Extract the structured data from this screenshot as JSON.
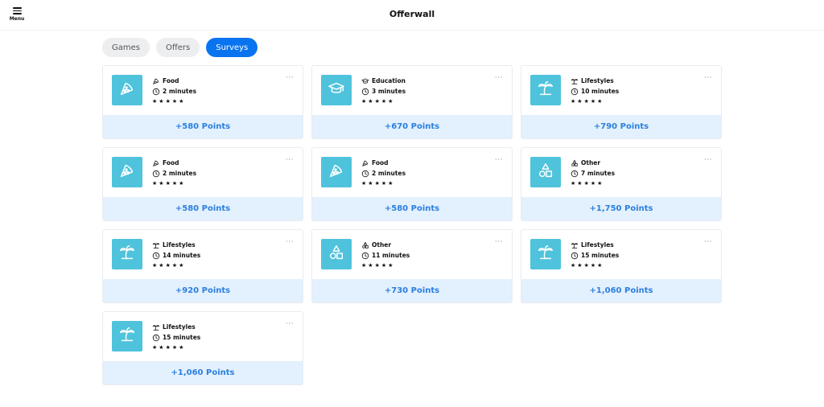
{
  "header": {
    "menu_label": "Menu",
    "title": "Offerwall"
  },
  "tabs": [
    {
      "label": "Games",
      "active": false
    },
    {
      "label": "Offers",
      "active": false
    },
    {
      "label": "Surveys",
      "active": true
    }
  ],
  "colors": {
    "accent": "#0a74f0",
    "thumb_bg": "#4fc3dc",
    "points_bg": "#e3f0fd",
    "points_text": "#2a7fe0"
  },
  "cards": [
    {
      "category": "Food",
      "icon": "pizza-icon",
      "duration": "2 minutes",
      "rating": 5,
      "points": "+580 Points"
    },
    {
      "category": "Education",
      "icon": "graduation-cap-icon",
      "duration": "3 minutes",
      "rating": 5,
      "points": "+670 Points"
    },
    {
      "category": "Lifestyles",
      "icon": "palm-tree-icon",
      "duration": "10 minutes",
      "rating": 5,
      "points": "+790 Points"
    },
    {
      "category": "Food",
      "icon": "pizza-icon",
      "duration": "2 minutes",
      "rating": 5,
      "points": "+580 Points"
    },
    {
      "category": "Food",
      "icon": "pizza-icon",
      "duration": "2 minutes",
      "rating": 5,
      "points": "+580 Points"
    },
    {
      "category": "Other",
      "icon": "shapes-icon",
      "duration": "7 minutes",
      "rating": 5,
      "points": "+1,750 Points"
    },
    {
      "category": "Lifestyles",
      "icon": "palm-tree-icon",
      "duration": "14 minutes",
      "rating": 5,
      "points": "+920 Points"
    },
    {
      "category": "Other",
      "icon": "shapes-icon",
      "duration": "11 minutes",
      "rating": 5,
      "points": "+730 Points"
    },
    {
      "category": "Lifestyles",
      "icon": "palm-tree-icon",
      "duration": "15 minutes",
      "rating": 5,
      "points": "+1,060 Points"
    },
    {
      "category": "Lifestyles",
      "icon": "palm-tree-icon",
      "duration": "15 minutes",
      "rating": 5,
      "points": "+1,060 Points"
    }
  ]
}
